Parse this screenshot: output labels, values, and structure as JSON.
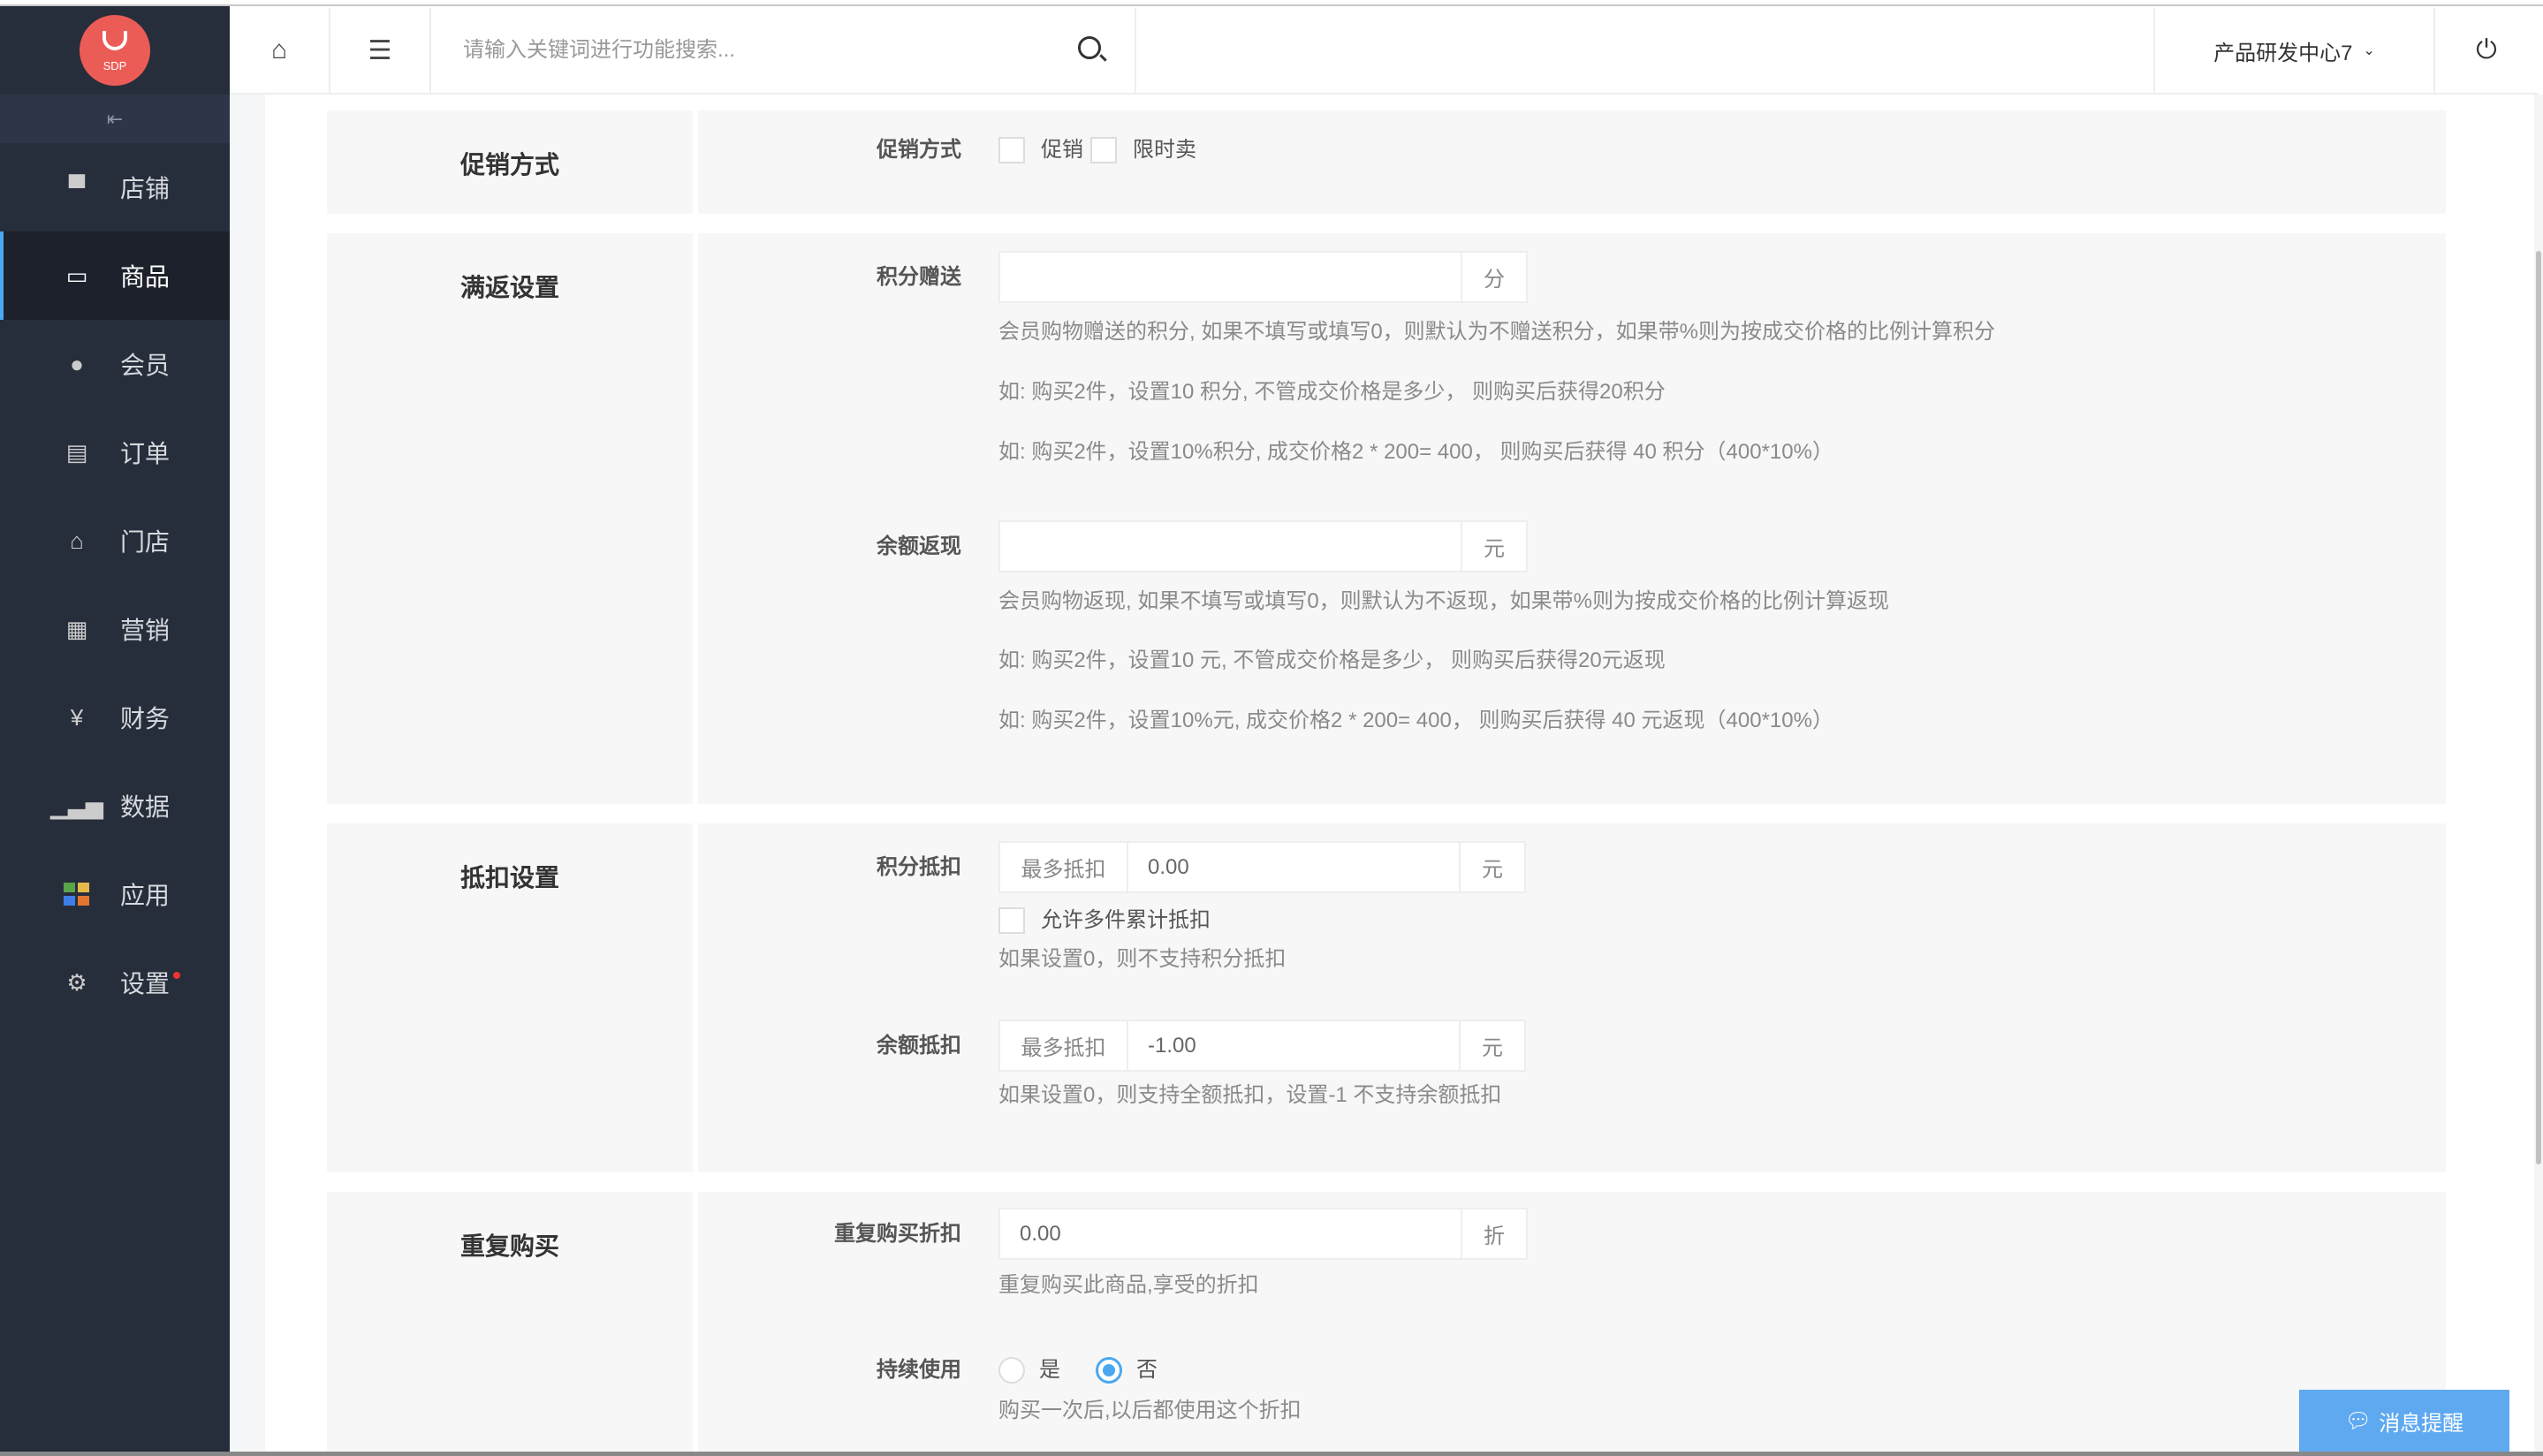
{
  "logo": {
    "text": "SDP"
  },
  "sidebar": {
    "items": [
      {
        "label": "店铺",
        "icon": "store-icon"
      },
      {
        "label": "商品",
        "icon": "bag-icon",
        "active": true
      },
      {
        "label": "会员",
        "icon": "user-icon"
      },
      {
        "label": "订单",
        "icon": "document-icon"
      },
      {
        "label": "门店",
        "icon": "shop-settings-icon"
      },
      {
        "label": "营销",
        "icon": "gift-icon"
      },
      {
        "label": "财务",
        "icon": "money-bag-icon"
      },
      {
        "label": "数据",
        "icon": "chart-icon"
      },
      {
        "label": "应用",
        "icon": "apps-icon"
      },
      {
        "label": "设置",
        "icon": "gear-icon"
      }
    ]
  },
  "header": {
    "search_placeholder": "请输入关键词进行功能搜索...",
    "store_name": "产品研发中心7"
  },
  "sections": {
    "promo": {
      "title": "促销方式",
      "label": "促销方式",
      "options": [
        "促销",
        "限时卖"
      ]
    },
    "reward": {
      "title": "满返设置",
      "points": {
        "label": "积分赠送",
        "value": "",
        "suffix": "分",
        "help": [
          "会员购物赠送的积分, 如果不填写或填写0，则默认为不赠送积分，如果带%则为按成交价格的比例计算积分",
          "如: 购买2件，设置10 积分, 不管成交价格是多少， 则购买后获得20积分",
          "如: 购买2件，设置10%积分, 成交价格2 * 200= 400， 则购买后获得 40 积分（400*10%）"
        ]
      },
      "balance": {
        "label": "余额返现",
        "value": "",
        "suffix": "元",
        "help": [
          "会员购物返现, 如果不填写或填写0，则默认为不返现，如果带%则为按成交价格的比例计算返现",
          "如: 购买2件，设置10 元, 不管成交价格是多少， 则购买后获得20元返现",
          "如: 购买2件，设置10%元, 成交价格2 * 200= 400， 则购买后获得 40 元返现（400*10%）"
        ]
      }
    },
    "deduct": {
      "title": "抵扣设置",
      "points": {
        "label": "积分抵扣",
        "prefix": "最多抵扣",
        "value": "0.00",
        "suffix": "元",
        "checkbox": "允许多件累计抵扣",
        "help": "如果设置0，则不支持积分抵扣"
      },
      "balance": {
        "label": "余额抵扣",
        "prefix": "最多抵扣",
        "value": "-1.00",
        "suffix": "元",
        "help": "如果设置0，则支持全额抵扣，设置-1 不支持余额抵扣"
      }
    },
    "repeat": {
      "title": "重复购买",
      "discount": {
        "label": "重复购买折扣",
        "value": "0.00",
        "suffix": "折",
        "help": "重复购买此商品,享受的折扣"
      },
      "continuous": {
        "label": "持续使用",
        "options": [
          "是",
          "否"
        ],
        "selected": "否",
        "help": "购买一次后,以后都使用这个折扣"
      }
    }
  },
  "message_button": "消息提醒",
  "colors": {
    "accent": "#4aa8f0",
    "sidebar": "#272e3b",
    "logo": "#ec5c56"
  }
}
